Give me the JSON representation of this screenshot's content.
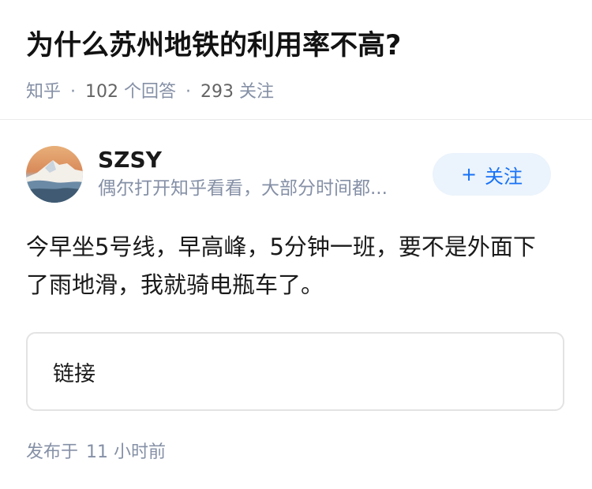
{
  "question": {
    "title": "为什么苏州地铁的利用率不高?",
    "source": "知乎",
    "answers_count": "102",
    "answers_label": "个回答",
    "followers_count": "293",
    "followers_label": "关注"
  },
  "answer": {
    "author_name": "SZSY",
    "author_bio": "偶尔打开知乎看看，大部分时间都...",
    "follow_plus": "+",
    "follow_label": "关注",
    "content": "今早坐5号线，早高峰，5分钟一班，要不是外面下了雨地滑，我就骑电瓶车了。",
    "link_label": "链接",
    "published_label": "发布于",
    "published_time": "11 小时前"
  },
  "colors": {
    "accent": "#1772f6",
    "follow_bg": "#ebf3fc",
    "meta_gray": "#8590a6"
  }
}
